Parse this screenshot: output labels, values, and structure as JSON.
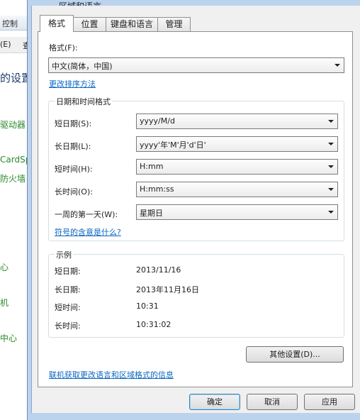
{
  "background_window": {
    "address_text": "控制",
    "menu_items": [
      "(E)",
      "查"
    ],
    "heading": "的设置",
    "links": [
      "驱动器",
      "CardSp",
      "防火墙",
      "心",
      "机",
      "中心"
    ]
  },
  "dialog": {
    "title": "区域和语言",
    "tabs": [
      {
        "label": "格式"
      },
      {
        "label": "位置"
      },
      {
        "label": "键盘和语言"
      },
      {
        "label": "管理"
      }
    ],
    "format": {
      "label": "格式(F):",
      "value": "中文(简体，中国)",
      "sort_link": "更改排序方法"
    },
    "datetime_group": {
      "legend": "日期和时间格式",
      "rows": [
        {
          "label": "短日期(S):",
          "value": "yyyy/M/d"
        },
        {
          "label": "长日期(L):",
          "value": "yyyy'年'M'月'd'日'"
        },
        {
          "label": "短时间(H):",
          "value": "H:mm"
        },
        {
          "label": "长时间(O):",
          "value": "H:mm:ss"
        },
        {
          "label": "一周的第一天(W):",
          "value": "星期日"
        }
      ],
      "symbols_link": "符号的含意是什么?"
    },
    "example_group": {
      "legend": "示例",
      "rows": [
        {
          "label": "短日期:",
          "value": "2013/11/16"
        },
        {
          "label": "长日期:",
          "value": "2013年11月16日"
        },
        {
          "label": "短时间:",
          "value": "10:31"
        },
        {
          "label": "长时间:",
          "value": "10:31:02"
        }
      ]
    },
    "other_settings_button": "其他设置(D)...",
    "online_link": "联机获取更改语言和区域格式的信息",
    "buttons": {
      "ok": "确定",
      "cancel": "取消",
      "apply": "应用"
    }
  }
}
